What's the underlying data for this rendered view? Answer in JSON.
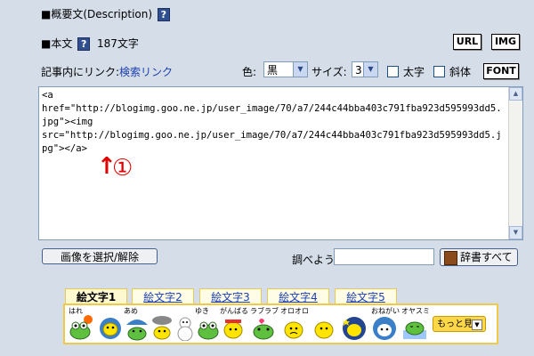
{
  "description": {
    "label": "■概要文(Description)",
    "help": "?"
  },
  "body": {
    "label": "■本文",
    "help": "?",
    "char_count": "187文字",
    "url_button": "URL",
    "img_button": "IMG"
  },
  "link_row": {
    "prefix": "記事内にリンク:",
    "search_link": "検索リンク",
    "color_label": "色:",
    "color_value": "黒",
    "size_label": "サイズ:",
    "size_value": "3",
    "bold_label": "太字",
    "italic_label": "斜体",
    "font_button": "FONT"
  },
  "editor": {
    "content": "<a\nhref=\"http://blogimg.goo.ne.jp/user_image/70/a7/244c44bba403c791fba923d595993dd5.jpg\"><img\nsrc=\"http://blogimg.goo.ne.jp/user_image/70/a7/244c44bba403c791fba923d595993dd5.jpg\"></a>"
  },
  "annotation": {
    "arrow": "↑",
    "number": "①",
    "color": "#e00000"
  },
  "actions": {
    "select_image_button": "画像を選択/解除",
    "lookup_label": "調べよう:",
    "lookup_value": "",
    "dictionary_button": "辞書すべて"
  },
  "emoji_tabs": [
    {
      "label": "絵文字1"
    },
    {
      "label": "絵文字2"
    },
    {
      "label": "絵文字3"
    },
    {
      "label": "絵文字4"
    },
    {
      "label": "絵文字5"
    }
  ],
  "emoji_icons": [
    {
      "label": "はれ"
    },
    {
      "label": ""
    },
    {
      "label": "あめ"
    },
    {
      "label": ""
    },
    {
      "label": ""
    },
    {
      "label": "ゆき"
    },
    {
      "label": "がんばる"
    },
    {
      "label": "ラブラブ"
    },
    {
      "label": "オロオロ"
    },
    {
      "label": ""
    },
    {
      "label": ""
    },
    {
      "label": "おねがい"
    },
    {
      "label": "オヤスミ"
    }
  ],
  "more_button": "もっと見る",
  "colors": {
    "background": "#d4dde8",
    "link": "#1c3fb0",
    "tab_border": "#f0c948"
  }
}
